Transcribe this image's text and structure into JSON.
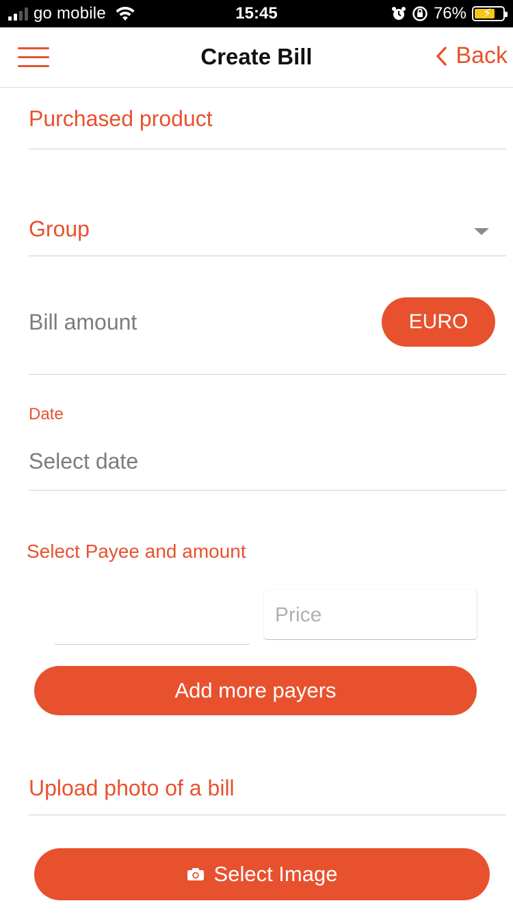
{
  "status_bar": {
    "carrier": "go mobile",
    "time": "15:45",
    "battery_percent": "76%",
    "battery_level": 0.76,
    "icons": [
      "signal-icon",
      "wifi-icon",
      "alarm-icon",
      "orientation-lock-icon",
      "battery-charging-icon"
    ]
  },
  "nav": {
    "title": "Create Bill",
    "back_label": "Back",
    "menu_icon": "hamburger-menu-icon",
    "back_icon": "chevron-left-icon"
  },
  "form": {
    "purchased_product_placeholder": "Purchased product",
    "group_label": "Group",
    "bill_amount_placeholder": "Bill amount",
    "currency_button": "EURO",
    "date_label": "Date",
    "date_placeholder": "Select date",
    "payee_section_title": "Select Payee and amount",
    "price_placeholder": "Price",
    "add_payers_button": "Add more payers",
    "upload_label": "Upload photo of a bill",
    "select_image_button": "Select Image"
  },
  "colors": {
    "accent": "#e8512e",
    "muted_text": "#7c7c7c",
    "divider": "#cfcfcf"
  }
}
